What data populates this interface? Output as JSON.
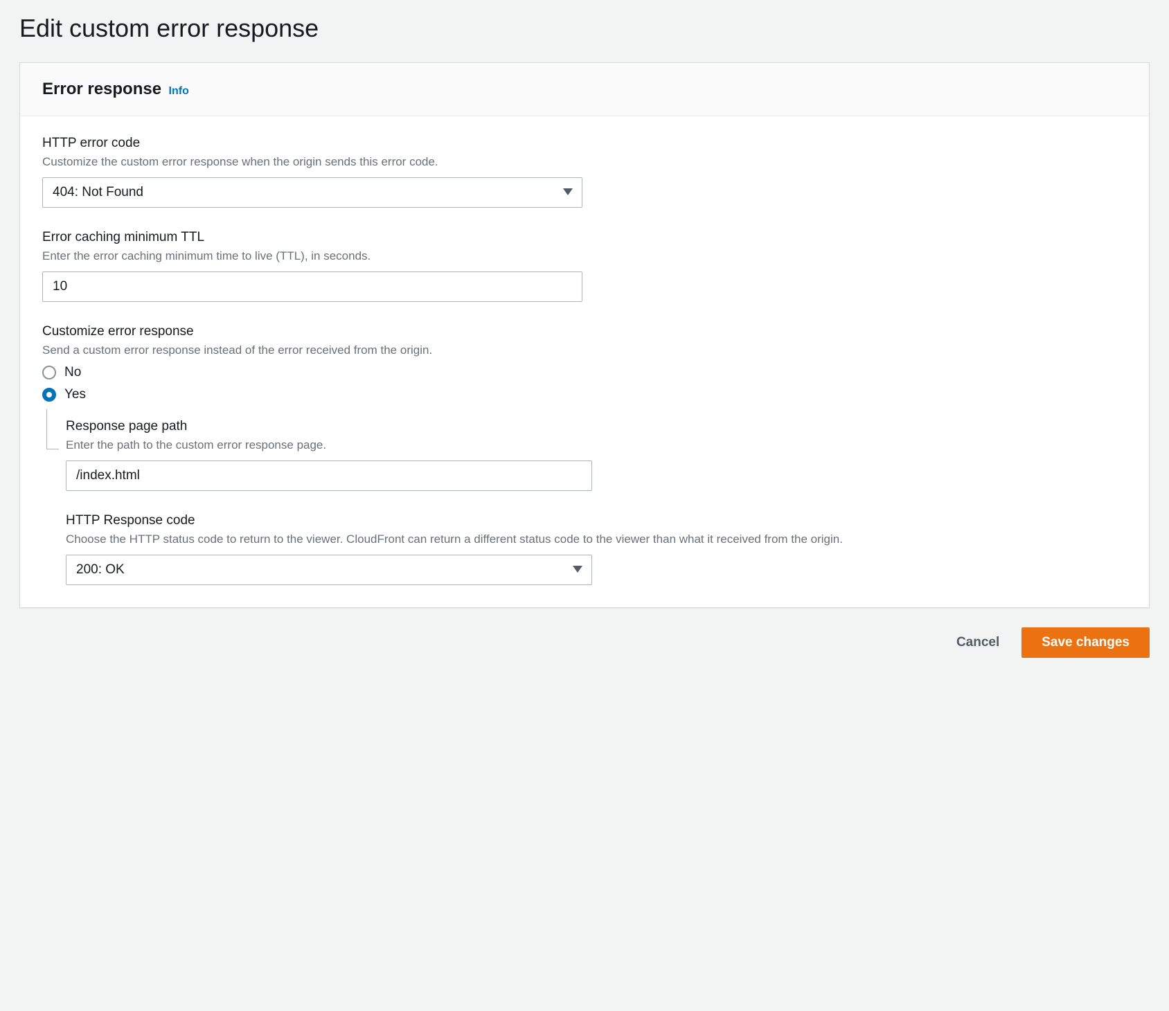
{
  "page": {
    "title": "Edit custom error response"
  },
  "panel": {
    "title": "Error response",
    "info_link": "Info"
  },
  "fields": {
    "http_error_code": {
      "label": "HTTP error code",
      "hint": "Customize the custom error response when the origin sends this error code.",
      "value": "404: Not Found"
    },
    "error_ttl": {
      "label": "Error caching minimum TTL",
      "hint": "Enter the error caching minimum time to live (TTL), in seconds.",
      "value": "10"
    },
    "customize": {
      "label": "Customize error response",
      "hint": "Send a custom error response instead of the error received from the origin.",
      "option_no": "No",
      "option_yes": "Yes",
      "selected": "yes"
    },
    "response_path": {
      "label": "Response page path",
      "hint": "Enter the path to the custom error response page.",
      "value": "/index.html"
    },
    "response_code": {
      "label": "HTTP Response code",
      "hint": "Choose the HTTP status code to return to the viewer. CloudFront can return a different status code to the viewer than what it received from the origin.",
      "value": "200: OK"
    }
  },
  "actions": {
    "cancel": "Cancel",
    "save": "Save changes"
  }
}
